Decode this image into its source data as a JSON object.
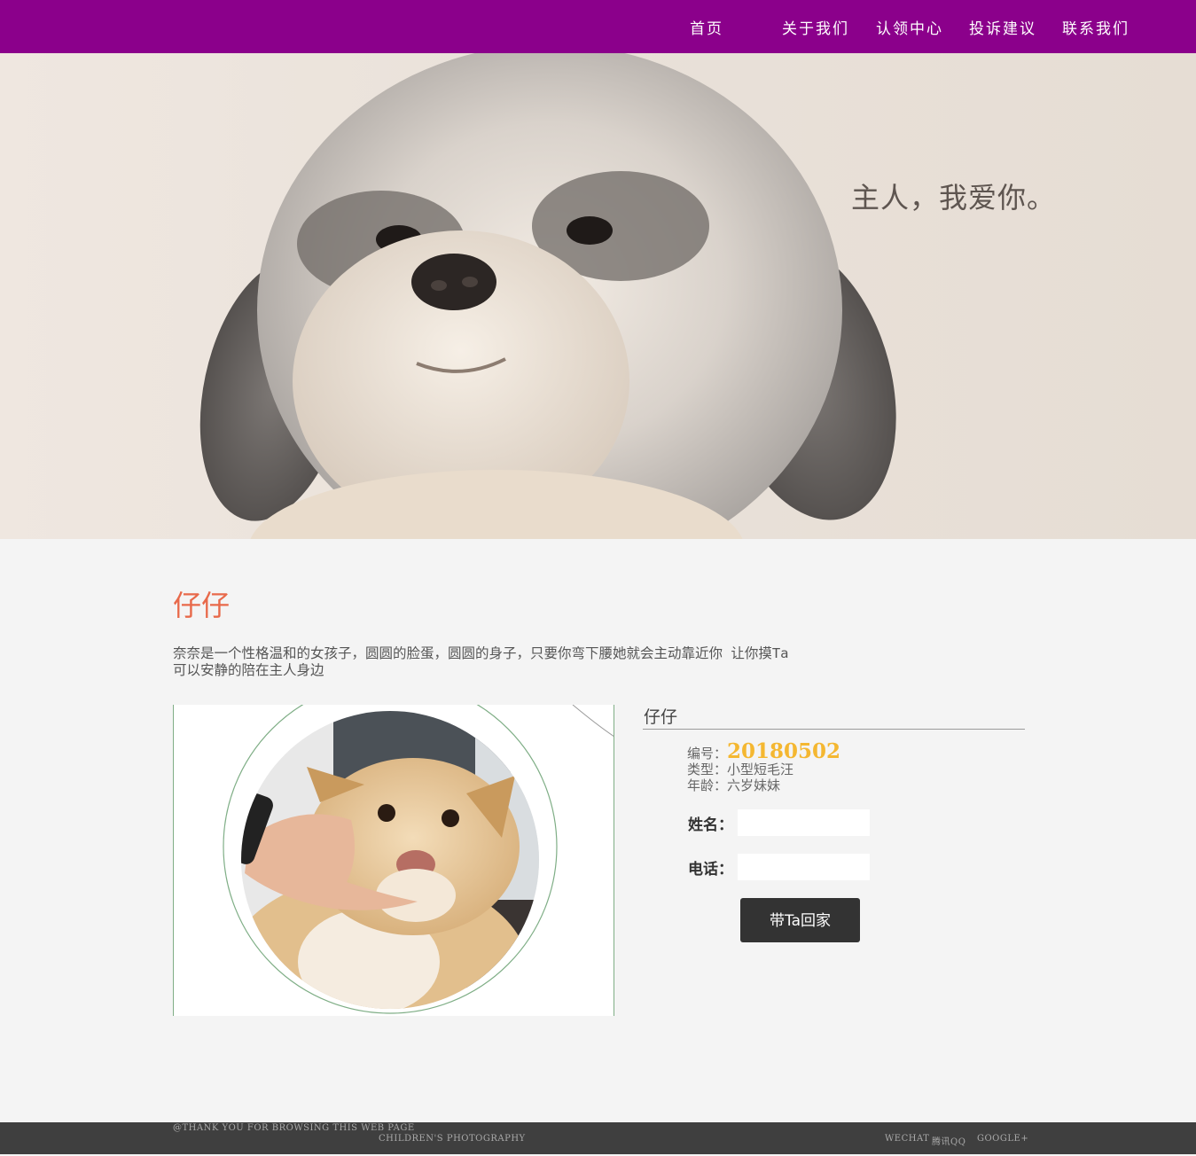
{
  "nav": {
    "items": [
      {
        "label": "首页"
      },
      {
        "label": "关于我们"
      },
      {
        "label": "认领中心"
      },
      {
        "label": "投诉建议"
      },
      {
        "label": "联系我们"
      }
    ]
  },
  "hero": {
    "caption": "主人，我爱你。"
  },
  "pet": {
    "title": "仔仔",
    "description": "奈奈是一个性格温和的女孩子，圆圆的脸蛋，圆圆的身子，只要你弯下腰她就会主动靠近你 让你摸Ta 可以安静的陪在主人身边",
    "card_title": "仔仔",
    "id_label": "编号：",
    "id_value": "20180502",
    "type_label": "类型：",
    "type_value": "小型短毛汪",
    "age_label": "年龄：",
    "age_value": "六岁妹妹"
  },
  "form": {
    "name_label": "姓名：",
    "name_value": "",
    "phone_label": "电话：",
    "phone_value": "",
    "submit_label": "带Ta回家"
  },
  "footer": {
    "thanks": "@THANK YOU FOR BROWSING THIS WEB PAGE",
    "subtitle": "CHILDREN'S PHOTOGRAPHY",
    "links": [
      {
        "label": "WECHAT"
      },
      {
        "label": "腾讯QQ"
      },
      {
        "label": "GOOGLE+"
      }
    ]
  },
  "colors": {
    "nav_bg": "#8b008b",
    "title_accent": "#e8694a",
    "id_accent": "#f4b731",
    "button_bg": "#333333",
    "footer_bg": "#3f3f3f"
  },
  "icons": {
    "hero_image": "shih-tzu-dog-photo",
    "pet_image": "golden-dog-being-petted-photo"
  }
}
